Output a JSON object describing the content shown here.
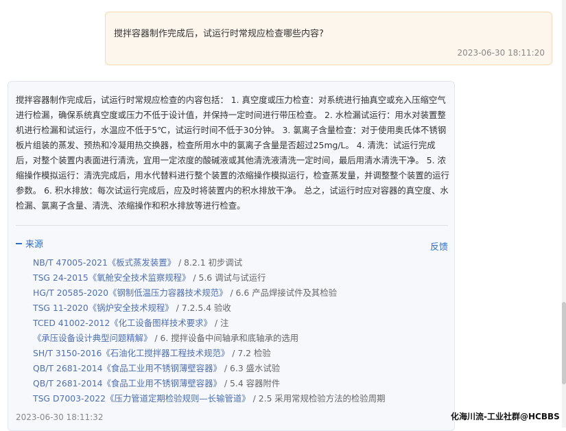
{
  "question": {
    "text": "搅拌容器制作完成后，试运行时常规应检查哪些内容?",
    "time": "2023-06-30 18:11:20"
  },
  "answer": {
    "text": "搅拌容器制作完成后，试运行时常规应检查的内容包括： 1. 真空度或压力检查：对系统进行抽真空或充入压缩空气进行检漏，确保系统真空度或压力不低于设计值，并保持一定时间进行带压检查。 2. 水检漏试运行：用水对装置整机进行检漏和试运行，水温应不低于5℃，试运行时间不低于30分钟。 3. 氯离子含量检查：对于使用奥氏体不锈钢板片组装的蒸发、预热和冷凝用热交换器，检查所用水中的氯离子含量是否超过25mg/L。 4. 清洗：试运行完成后，对整个装置内表面进行清洗，宜用一定浓度的酸碱液或其他清洗液清洗一定时间，最后用清水清洗干净。 5. 浓缩操作模拟运行：清洗完成后，用水代替料进行整个装置的浓缩操作模拟运行，检查蒸发量，并调整整个装置的运行参数。 6. 积水排放：每次试运行完成后，应及时将装置内的积水排放干净。 总之，试运行时应对容器的真空度、水检漏、氯离子含量、清洗、浓缩操作和积水排放等进行检查。",
    "time": "2023-06-30 18:11:32",
    "sources_label": "来源",
    "feedback_label": "反馈",
    "sources": [
      {
        "title": "NB/T 47005-2021《板式蒸发装置》",
        "section": " / 8.2.1 初步调试"
      },
      {
        "title": "TSG 24-2015《氧舱安全技术监察规程》",
        "section": " / 5.6 调试与试运行"
      },
      {
        "title": "HG/T 20585-2020《钢制低温压力容器技术规范》",
        "section": " / 6.6 产品焊接试件及其检验"
      },
      {
        "title": "TSG 11-2020《锅炉安全技术规程》",
        "section": " / 7.2.5.4 验收"
      },
      {
        "title": "TCED 41002-2012《化工设备图样技术要求》",
        "section": " / 注"
      },
      {
        "title": "《承压设备设计典型问题精解》",
        "section": " / 6. 搅拌设备中间轴承和底轴承的选用"
      },
      {
        "title": "SH/T 3150-2016《石油化工搅拌器工程技术规范》",
        "section": " / 7.2 检验"
      },
      {
        "title": "QB/T 2681-2014《食品工业用不锈钢薄壁容器》",
        "section": " / 6.3 盛水试验"
      },
      {
        "title": "QB/T 2681-2014《食品工业用不锈钢薄壁容器》",
        "section": " / 5.4 容器附件"
      },
      {
        "title": "TSG D7003-2022《压力管道定期检验规则—长输管道》",
        "section": " / 2.5 采用常规检验方法的检验周期"
      }
    ]
  },
  "watermark": "化海川流-工业社群@HCBBS"
}
